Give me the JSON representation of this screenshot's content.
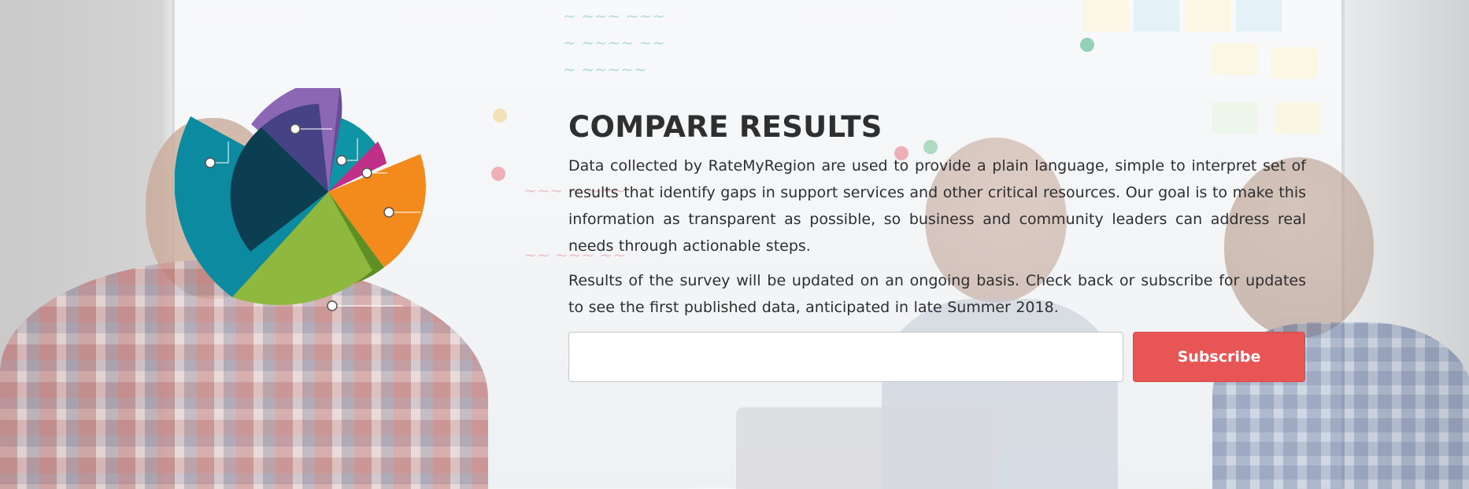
{
  "section": {
    "title": "COMPARE RESULTS",
    "paragraphs": [
      "Data collected by RateMyRegion are used to provide a plain language, simple to interpret set of results that identify gaps in support services and other critical resources. Our goal is to make this information as transparent as possible, so business and community leaders can address real needs through actionable steps.",
      "Results of the survey will be updated on an ongoing basis. Check back or subscribe for updates to see the first published data, anticipated in late Summer 2018."
    ]
  },
  "form": {
    "email_value": "",
    "email_placeholder": "",
    "subscribe_label": "Subscribe"
  },
  "colors": {
    "accent": "#e85555",
    "title": "#2f2f2f",
    "text": "#2e2e2e"
  },
  "logo": {
    "icon": "segmented-pie-chart-logo",
    "segment_colors": [
      "#0f8fa3",
      "#7f5aa8",
      "#b7338a",
      "#f08a1e",
      "#86b23a",
      "#0b6e7e"
    ]
  }
}
